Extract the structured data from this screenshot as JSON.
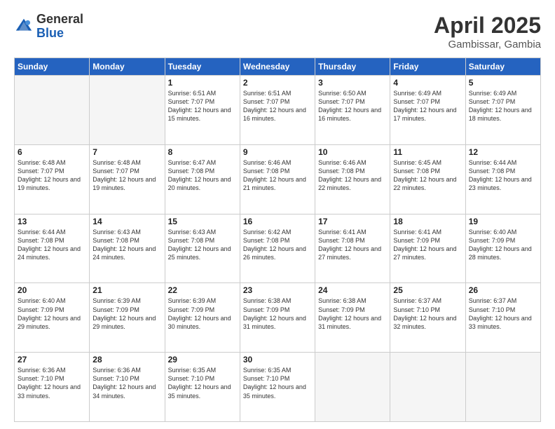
{
  "header": {
    "logo_general": "General",
    "logo_blue": "Blue",
    "title": "April 2025",
    "location": "Gambissar, Gambia"
  },
  "weekdays": [
    "Sunday",
    "Monday",
    "Tuesday",
    "Wednesday",
    "Thursday",
    "Friday",
    "Saturday"
  ],
  "weeks": [
    [
      {
        "day": "",
        "empty": true
      },
      {
        "day": "",
        "empty": true
      },
      {
        "day": "1",
        "sunrise": "6:51 AM",
        "sunset": "7:07 PM",
        "daylight": "12 hours and 15 minutes."
      },
      {
        "day": "2",
        "sunrise": "6:51 AM",
        "sunset": "7:07 PM",
        "daylight": "12 hours and 16 minutes."
      },
      {
        "day": "3",
        "sunrise": "6:50 AM",
        "sunset": "7:07 PM",
        "daylight": "12 hours and 16 minutes."
      },
      {
        "day": "4",
        "sunrise": "6:49 AM",
        "sunset": "7:07 PM",
        "daylight": "12 hours and 17 minutes."
      },
      {
        "day": "5",
        "sunrise": "6:49 AM",
        "sunset": "7:07 PM",
        "daylight": "12 hours and 18 minutes."
      }
    ],
    [
      {
        "day": "6",
        "sunrise": "6:48 AM",
        "sunset": "7:07 PM",
        "daylight": "12 hours and 19 minutes."
      },
      {
        "day": "7",
        "sunrise": "6:48 AM",
        "sunset": "7:07 PM",
        "daylight": "12 hours and 19 minutes."
      },
      {
        "day": "8",
        "sunrise": "6:47 AM",
        "sunset": "7:08 PM",
        "daylight": "12 hours and 20 minutes."
      },
      {
        "day": "9",
        "sunrise": "6:46 AM",
        "sunset": "7:08 PM",
        "daylight": "12 hours and 21 minutes."
      },
      {
        "day": "10",
        "sunrise": "6:46 AM",
        "sunset": "7:08 PM",
        "daylight": "12 hours and 22 minutes."
      },
      {
        "day": "11",
        "sunrise": "6:45 AM",
        "sunset": "7:08 PM",
        "daylight": "12 hours and 22 minutes."
      },
      {
        "day": "12",
        "sunrise": "6:44 AM",
        "sunset": "7:08 PM",
        "daylight": "12 hours and 23 minutes."
      }
    ],
    [
      {
        "day": "13",
        "sunrise": "6:44 AM",
        "sunset": "7:08 PM",
        "daylight": "12 hours and 24 minutes."
      },
      {
        "day": "14",
        "sunrise": "6:43 AM",
        "sunset": "7:08 PM",
        "daylight": "12 hours and 24 minutes."
      },
      {
        "day": "15",
        "sunrise": "6:43 AM",
        "sunset": "7:08 PM",
        "daylight": "12 hours and 25 minutes."
      },
      {
        "day": "16",
        "sunrise": "6:42 AM",
        "sunset": "7:08 PM",
        "daylight": "12 hours and 26 minutes."
      },
      {
        "day": "17",
        "sunrise": "6:41 AM",
        "sunset": "7:08 PM",
        "daylight": "12 hours and 27 minutes."
      },
      {
        "day": "18",
        "sunrise": "6:41 AM",
        "sunset": "7:09 PM",
        "daylight": "12 hours and 27 minutes."
      },
      {
        "day": "19",
        "sunrise": "6:40 AM",
        "sunset": "7:09 PM",
        "daylight": "12 hours and 28 minutes."
      }
    ],
    [
      {
        "day": "20",
        "sunrise": "6:40 AM",
        "sunset": "7:09 PM",
        "daylight": "12 hours and 29 minutes."
      },
      {
        "day": "21",
        "sunrise": "6:39 AM",
        "sunset": "7:09 PM",
        "daylight": "12 hours and 29 minutes."
      },
      {
        "day": "22",
        "sunrise": "6:39 AM",
        "sunset": "7:09 PM",
        "daylight": "12 hours and 30 minutes."
      },
      {
        "day": "23",
        "sunrise": "6:38 AM",
        "sunset": "7:09 PM",
        "daylight": "12 hours and 31 minutes."
      },
      {
        "day": "24",
        "sunrise": "6:38 AM",
        "sunset": "7:09 PM",
        "daylight": "12 hours and 31 minutes."
      },
      {
        "day": "25",
        "sunrise": "6:37 AM",
        "sunset": "7:10 PM",
        "daylight": "12 hours and 32 minutes."
      },
      {
        "day": "26",
        "sunrise": "6:37 AM",
        "sunset": "7:10 PM",
        "daylight": "12 hours and 33 minutes."
      }
    ],
    [
      {
        "day": "27",
        "sunrise": "6:36 AM",
        "sunset": "7:10 PM",
        "daylight": "12 hours and 33 minutes."
      },
      {
        "day": "28",
        "sunrise": "6:36 AM",
        "sunset": "7:10 PM",
        "daylight": "12 hours and 34 minutes."
      },
      {
        "day": "29",
        "sunrise": "6:35 AM",
        "sunset": "7:10 PM",
        "daylight": "12 hours and 35 minutes."
      },
      {
        "day": "30",
        "sunrise": "6:35 AM",
        "sunset": "7:10 PM",
        "daylight": "12 hours and 35 minutes."
      },
      {
        "day": "",
        "empty": true
      },
      {
        "day": "",
        "empty": true
      },
      {
        "day": "",
        "empty": true
      }
    ]
  ]
}
